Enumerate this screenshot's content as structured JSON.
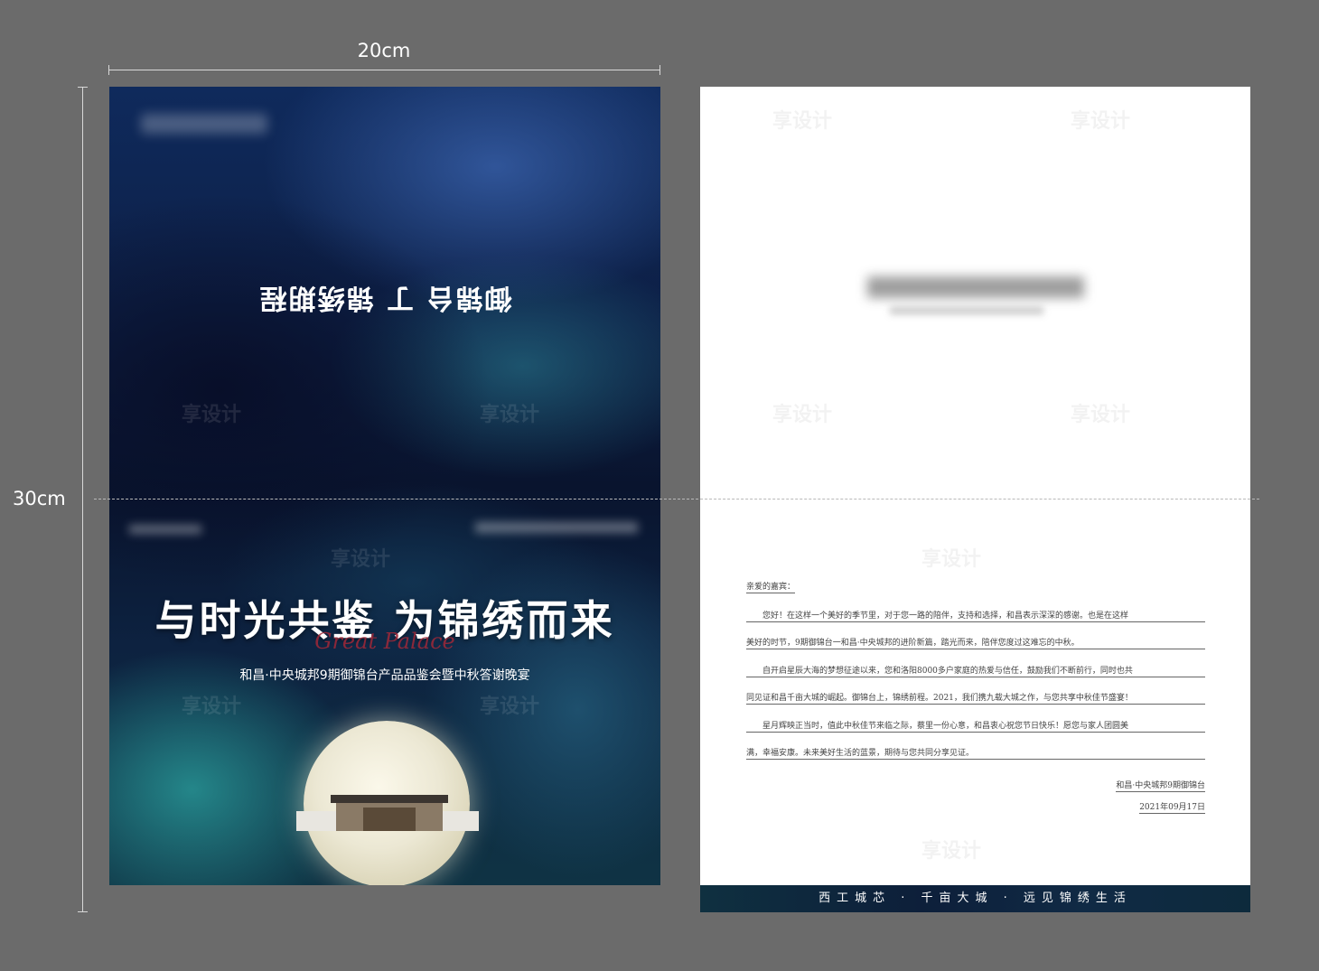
{
  "dimensions": {
    "width_label": "20cm",
    "height_label": "30cm"
  },
  "cover": {
    "top_title_inverted": "御锦台 丁 锦绣期程",
    "main_title": "与时光共鉴 为锦绣而来",
    "script_text": "Great Palace",
    "subtitle": "和昌·中央城邦9期御锦台产品品鉴会暨中秋答谢晚宴"
  },
  "letter": {
    "greeting": "亲爱的嘉宾：",
    "lines": [
      "　　您好！在这样一个美好的季节里，对于您一路的陪伴，支持和选择，和昌表示深深的感谢。也是在这样",
      "美好的时节，9期御锦台一和昌·中央城邦的进阶新篇，踏光而来，陪伴您度过这难忘的中秋。",
      "　　自开启星辰大海的梦想征途以来，您和洛阳8000多户家庭的热爱与信任，鼓励我们不断前行，同时也共",
      "同见证和昌千亩大城的崛起。御锦台上，锦绣前程。2021，我们携九载大城之作，与您共享中秋佳节盛宴！",
      "　　星月辉映正当时，值此中秋佳节来临之际，蔡里一份心意，和昌衷心祝您节日快乐！愿您与家人团圆美",
      "满，幸福安康。未来美好生活的蓝景，期待与您共同分享见证。"
    ],
    "signature": "和昌·中央城邦9期御锦台",
    "date": "2021年09月17日",
    "footer": "西工城芯 · 千亩大城 · 远见锦绣生活"
  },
  "watermark": {
    "text": "享设计"
  }
}
